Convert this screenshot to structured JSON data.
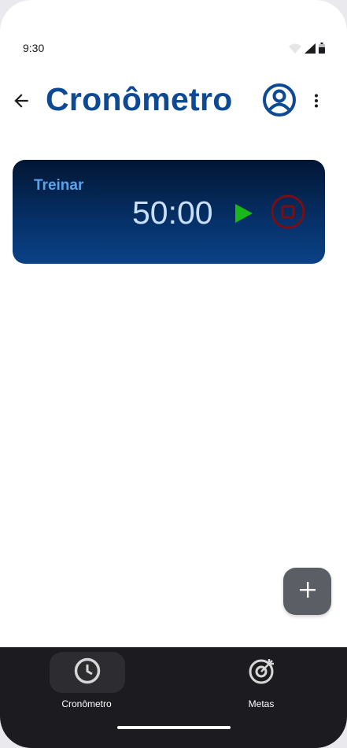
{
  "status_bar": {
    "time": "9:30"
  },
  "app_bar": {
    "title": "Cronômetro",
    "back_icon": "arrow-back-icon",
    "account_icon": "account-circle-icon",
    "more_icon": "more-vert-icon"
  },
  "timer": {
    "label": "Treinar",
    "time": "50:00",
    "play_icon": "play-icon",
    "stop_icon": "stop-icon"
  },
  "fab": {
    "icon": "add-icon"
  },
  "bottom_nav": {
    "items": [
      {
        "label": "Cronômetro",
        "icon": "clock-icon",
        "active": true
      },
      {
        "label": "Metas",
        "icon": "target-icon",
        "active": false
      }
    ]
  },
  "colors": {
    "title": "#0d4a93",
    "timer_label": "#5aa3ec",
    "timer_time": "#c9e0fb",
    "play": "#19b819",
    "stop": "#7a0e12",
    "nav_background": "#1c1b20",
    "fab_background": "#5b5e64"
  }
}
